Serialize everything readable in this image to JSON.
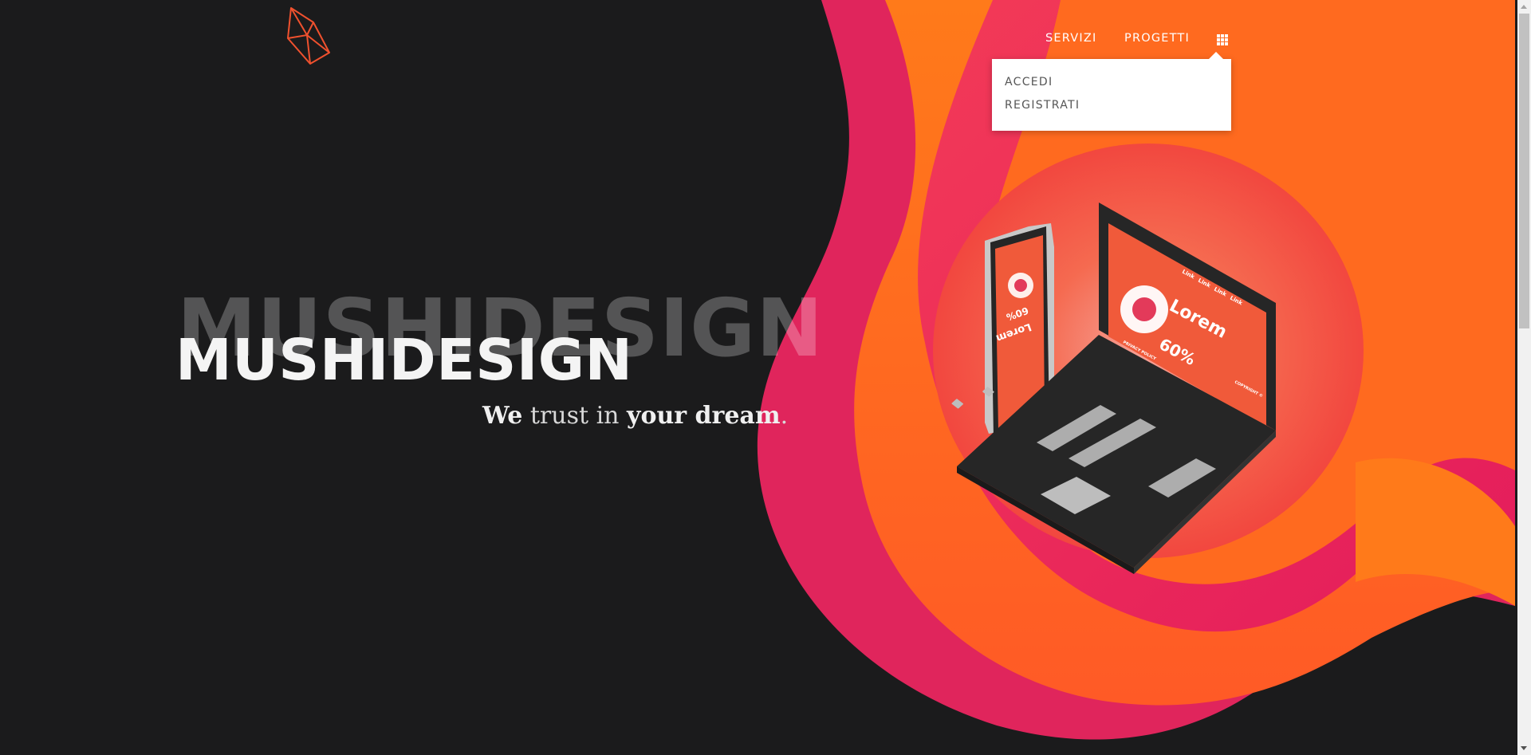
{
  "brand": {
    "name": "MUSHIDESIGN",
    "ghost_name": "MUSHIDESIGN",
    "accent": "#ff6a1f",
    "accent2": "#e0185f",
    "background": "#1b1b1c"
  },
  "nav": {
    "items": [
      {
        "label": "SERVIZI"
      },
      {
        "label": "PROGETTI"
      }
    ],
    "menu_icon": "grid-icon"
  },
  "dropdown": {
    "items": [
      {
        "label": "ACCEDI"
      },
      {
        "label": "REGISTRATI"
      }
    ]
  },
  "tagline": {
    "w1": "We",
    "w2": " trust in ",
    "w3": "your dream",
    "w4": "."
  },
  "illustration": {
    "laptop_title": "Lorem",
    "laptop_percent": "60%",
    "laptop_links": [
      "Link",
      "Link",
      "Link",
      "Link"
    ],
    "laptop_footer_left": "PRIVACY POLICY",
    "laptop_footer_right": "COPYRIGHT ©",
    "phone_title": "Lorem",
    "phone_percent": "60%"
  }
}
